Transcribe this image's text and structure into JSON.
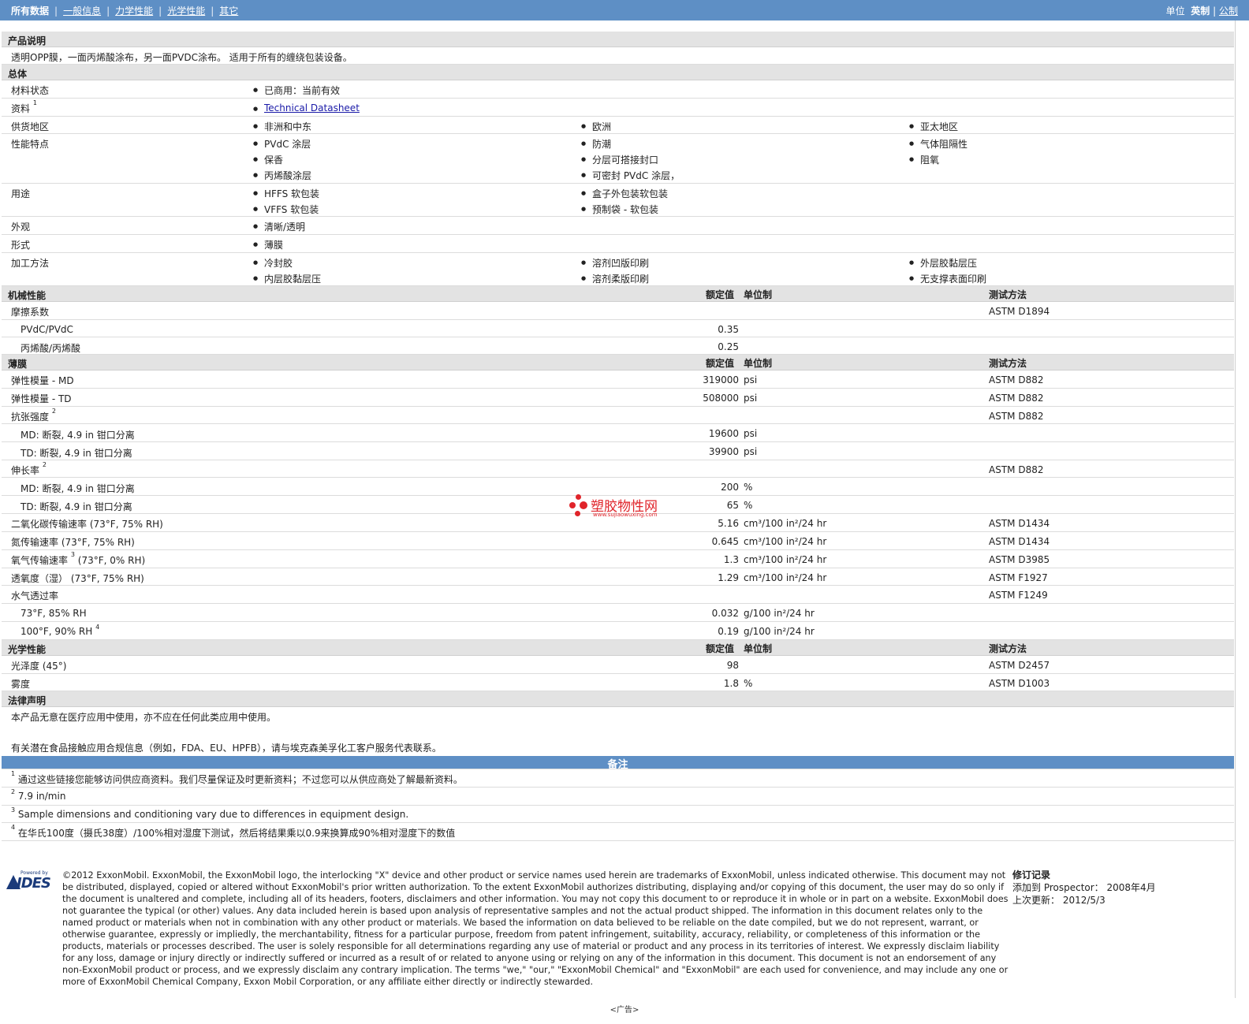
{
  "nav": {
    "items": [
      "所有数据",
      "一般信息",
      "力学性能",
      "光学性能",
      "其它"
    ],
    "sep": "|"
  },
  "units": {
    "label": "单位",
    "imperial": "英制",
    "sep": "|",
    "metric": "公制"
  },
  "desc": {
    "title": "产品说明",
    "text": "透明OPP膜，一面丙烯酸涂布，另一面PVDC涂布。 适用于所有的缠绕包装设备。"
  },
  "general": {
    "title": "总体",
    "status_label": "材料状态",
    "status_value": "已商用：当前有效",
    "docs_label": "资料",
    "docs_sup": "1",
    "docs_link": "Technical Datasheet",
    "region_label": "供货地区",
    "regions": [
      "非洲和中东",
      "欧洲",
      "亚太地区"
    ],
    "features_label": "性能特点",
    "features": [
      "PVdC 涂层",
      "防潮",
      "气体阻隔性",
      "保香",
      "分层可搭接封口",
      "阻氧",
      "丙烯酸涂层",
      "可密封 PVdC 涂层，"
    ],
    "uses_label": "用途",
    "uses": [
      "HFFS 软包装",
      "盒子外包装软包装",
      "VFFS 软包装",
      "预制袋 - 软包装"
    ],
    "appearance_label": "外观",
    "appearance": "清晰/透明",
    "form_label": "形式",
    "form": "薄膜",
    "process_label": "加工方法",
    "process": [
      "冷封胶",
      "溶剂凹版印刷",
      "外层胶黏层压",
      "内层胶黏层压",
      "溶剂柔版印刷",
      "无支撑表面印刷"
    ]
  },
  "headers": {
    "nominal": "额定值",
    "unit": "单位制",
    "method": "测试方法"
  },
  "mech": {
    "title": "机械性能",
    "cof_label": "摩擦系数",
    "cof_method": "ASTM D1894",
    "cof_rows": [
      {
        "label": "PVdC/PVdC",
        "value": "0.35"
      },
      {
        "label": "丙烯酸/丙烯酸",
        "value": "0.25"
      }
    ]
  },
  "film": {
    "title": "薄膜",
    "rows": [
      {
        "label": "弹性模量 - MD",
        "value": "319000",
        "unit": "psi",
        "method": "ASTM D882"
      },
      {
        "label": "弹性模量 - TD",
        "value": "508000",
        "unit": "psi",
        "method": "ASTM D882"
      }
    ],
    "tensile_label": "抗张强度",
    "tensile_sup": "2",
    "tensile_method": "ASTM D882",
    "tensile_rows": [
      {
        "label": "MD: 断裂, 4.9 in 钳口分离",
        "value": "19600",
        "unit": "psi"
      },
      {
        "label": "TD: 断裂, 4.9 in 钳口分离",
        "value": "39900",
        "unit": "psi"
      }
    ],
    "elong_label": "伸长率",
    "elong_sup": "2",
    "elong_method": "ASTM D882",
    "elong_rows": [
      {
        "label": "MD: 断裂, 4.9 in 钳口分离",
        "value": "200",
        "unit": "%"
      },
      {
        "label": "TD: 断裂, 4.9 in 钳口分离",
        "value": "65",
        "unit": "%"
      }
    ],
    "gas_rows": [
      {
        "label": "二氧化碳传输速率",
        "cond": "(73°F, 75% RH)",
        "sup": "",
        "value": "5.16",
        "unit": "cm³/100 in²/24 hr",
        "method": "ASTM D1434"
      },
      {
        "label": "氮传输速率",
        "cond": "(73°F, 75% RH)",
        "sup": "",
        "value": "0.645",
        "unit": "cm³/100 in²/24 hr",
        "method": "ASTM D1434"
      },
      {
        "label": "氧气传输速率",
        "cond": "(73°F, 0% RH)",
        "sup": "3",
        "value": "1.3",
        "unit": "cm³/100 in²/24 hr",
        "method": "ASTM D3985"
      },
      {
        "label": "透氧度（湿）",
        "cond": "(73°F, 75% RH)",
        "sup": "",
        "value": "1.29",
        "unit": "cm³/100 in²/24 hr",
        "method": "ASTM F1927"
      }
    ],
    "wvtr_label": "水气透过率",
    "wvtr_method": "ASTM F1249",
    "wvtr_rows": [
      {
        "label": "73°F, 85% RH",
        "sup": "",
        "value": "0.032",
        "unit": "g/100 in²/24 hr"
      },
      {
        "label": "100°F, 90% RH",
        "sup": "4",
        "value": "0.19",
        "unit": "g/100 in²/24 hr"
      }
    ]
  },
  "optical": {
    "title": "光学性能",
    "rows": [
      {
        "label": "光泽度 (45°)",
        "value": "98",
        "unit": "",
        "method": "ASTM D2457"
      },
      {
        "label": "雾度",
        "value": "1.8",
        "unit": "%",
        "method": "ASTM D1003"
      }
    ]
  },
  "legal": {
    "title": "法律声明",
    "line1": "本产品无意在医疗应用中使用，亦不应在任何此类应用中使用。",
    "line2": "有关潜在食品接触应用合规信息（例如，FDA、EU、HPFB），请与埃克森美孚化工客户服务代表联系。"
  },
  "notes": {
    "title": "备注",
    "items": [
      {
        "n": "1",
        "text": "通过这些链接您能够访问供应商资料。我们尽量保证及时更新资料；不过您可以从供应商处了解最新资料。"
      },
      {
        "n": "2",
        "text": "7.9 in/min"
      },
      {
        "n": "3",
        "text": "Sample dimensions and conditioning vary due to differences in equipment design."
      },
      {
        "n": "4",
        "text": "在华氏100度（摄氏38度）/100%相对湿度下测试，然后将结果乘以0.9来换算成90%相对湿度下的数值"
      }
    ]
  },
  "footer": {
    "powered": "Powered by",
    "ides": "IDES",
    "legal_text": "©2012 ExxonMobil. ExxonMobil, the ExxonMobil logo, the interlocking \"X\" device and other product or service names used herein are trademarks of ExxonMobil, unless indicated otherwise. This document may not be distributed, displayed, copied or altered without ExxonMobil's prior written authorization. To the extent ExxonMobil authorizes distributing, displaying and/or copying of this document, the user may do so only if the document is unaltered and complete, including all of its headers, footers, disclaimers and other information. You may not copy this document to or reproduce it in whole or in part on a website. ExxonMobil does not guarantee the typical (or other) values. Any data included herein is based upon analysis of representative samples and not the actual product shipped. The information in this document relates only to the named product or materials when not in combination with any other product or materials. We based the information on data believed to be reliable on the date compiled, but we do not represent, warrant, or otherwise guarantee, expressly or impliedly, the merchantability, fitness for a particular purpose, freedom from patent infringement, suitability, accuracy, reliability, or completeness of this information or the products, materials or processes described. The user is solely responsible for all determinations regarding any use of material or product and any process in its territories of interest. We expressly disclaim liability for any loss, damage or injury directly or indirectly suffered or incurred as a result of or related to anyone using or relying on any of the information in this document. This document is not an endorsement of any non-ExxonMobil product or process, and we expressly disclaim any contrary implication. The terms \"we,\" \"our,\" \"ExxonMobil Chemical\" and \"ExxonMobil\" are each used for convenience, and may include any one or more of ExxonMobil Chemical Company, Exxon Mobil Corporation, or any affiliate either directly or indirectly stewarded.",
    "rev_title": "修订记录",
    "rev_added": "添加到 Prospector： 2008年4月",
    "rev_updated": "上次更新： 2012/5/3",
    "ad": "<广告>"
  },
  "watermark": {
    "text": "塑胶物性网",
    "url": "www.sujiaowuxing.com"
  },
  "colors": {
    "topbar": "#5e8fc5",
    "section": "#e3e3e3",
    "link": "#1a1aa8",
    "watermark": "#e0242a"
  }
}
